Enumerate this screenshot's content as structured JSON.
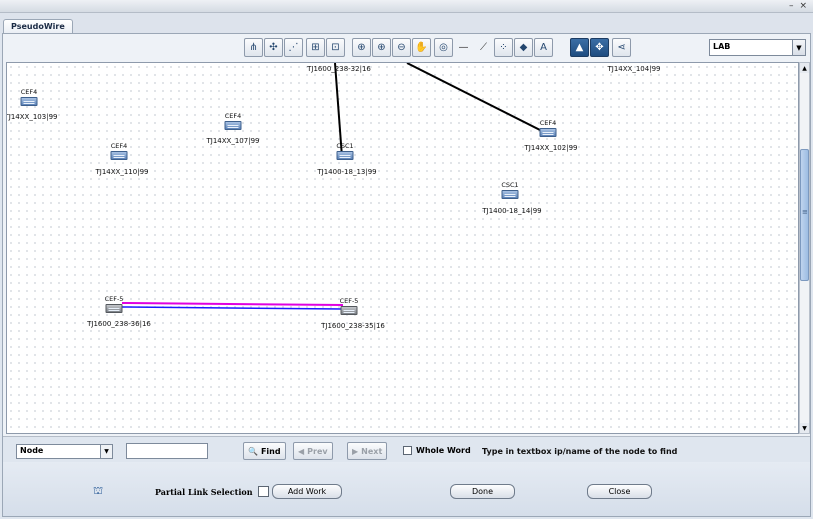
{
  "window": {
    "minimize_glyph": "–",
    "close_glyph": "×"
  },
  "tab": {
    "label": "PseudoWire"
  },
  "toolbar": {
    "buttons": [
      {
        "name": "layout-hierarchical-icon",
        "glyph": "⋔"
      },
      {
        "name": "layout-circular-icon",
        "glyph": "✣"
      },
      {
        "name": "layout-tree-icon",
        "glyph": "⋰"
      },
      {
        "name": "layout-grid-icon",
        "glyph": "⊞"
      },
      {
        "name": "layout-orthogonal-icon",
        "glyph": "⊡"
      },
      {
        "name": "zoom-fit-icon",
        "glyph": "⊕"
      },
      {
        "name": "zoom-in-icon",
        "glyph": "⊕"
      },
      {
        "name": "zoom-out-icon",
        "glyph": "⊖"
      },
      {
        "name": "hand-pan-icon",
        "glyph": "✋"
      },
      {
        "name": "overview-icon",
        "glyph": "◎"
      },
      {
        "name": "link-line-icon",
        "glyph": "—"
      },
      {
        "name": "link-diagonal-icon",
        "glyph": "⟋"
      },
      {
        "name": "node-select-icon",
        "glyph": "⁘"
      },
      {
        "name": "multi-select-icon",
        "glyph": "◆"
      },
      {
        "name": "label-toggle-icon",
        "glyph": "A"
      },
      {
        "name": "collapse-icon",
        "glyph": "▲"
      },
      {
        "name": "expand-icon",
        "glyph": "✥"
      },
      {
        "name": "share-icon",
        "glyph": "⋖"
      }
    ],
    "view_select": "LAB",
    "dropdown_glyph": "▼"
  },
  "topology": {
    "nodes": [
      {
        "type": "CEF4",
        "label": "TJ14XX_103|99"
      },
      {
        "type": "CEF4",
        "label": "TJ14XX_107|99"
      },
      {
        "type": "CEF4",
        "label": "TJ14XX_110|99"
      },
      {
        "type": "CSC1",
        "label": "TJ1400-18_13|99"
      },
      {
        "type": "CEF4",
        "label": "TJ14XX_102|99"
      },
      {
        "type": "CSC1",
        "label": "TJ1400-18_14|99"
      },
      {
        "type": "CEF-5",
        "label": "TJ1600_238-36|16"
      },
      {
        "type": "CEF-5",
        "label": "TJ1600_238-35|16"
      }
    ],
    "partial_labels": [
      {
        "label": "TJ1600_238-32|16"
      },
      {
        "label": "TJ14XX_104|99"
      }
    ],
    "link_colors": {
      "black": "#000000",
      "magenta": "#e000e0",
      "blue": "#1a1aff"
    }
  },
  "scroll": {
    "up_glyph": "▲",
    "down_glyph": "▼",
    "grip_glyph": "≡"
  },
  "find": {
    "type_select": "Node",
    "type_arrow": "▼",
    "input_value": "",
    "find_label": "Find",
    "find_icon": "🔍",
    "prev_label": "Prev",
    "prev_icon": "◀",
    "next_label": "Next",
    "next_icon": "▶",
    "whole_word_label": "Whole Word",
    "hint": "Type in textbox ip/name of the node to find"
  },
  "actions": {
    "network_icon": "⛫",
    "partial_link_label": "Partial Link Selection",
    "add_work_label": "Add Work",
    "done_label": "Done",
    "close_label": "Close"
  }
}
